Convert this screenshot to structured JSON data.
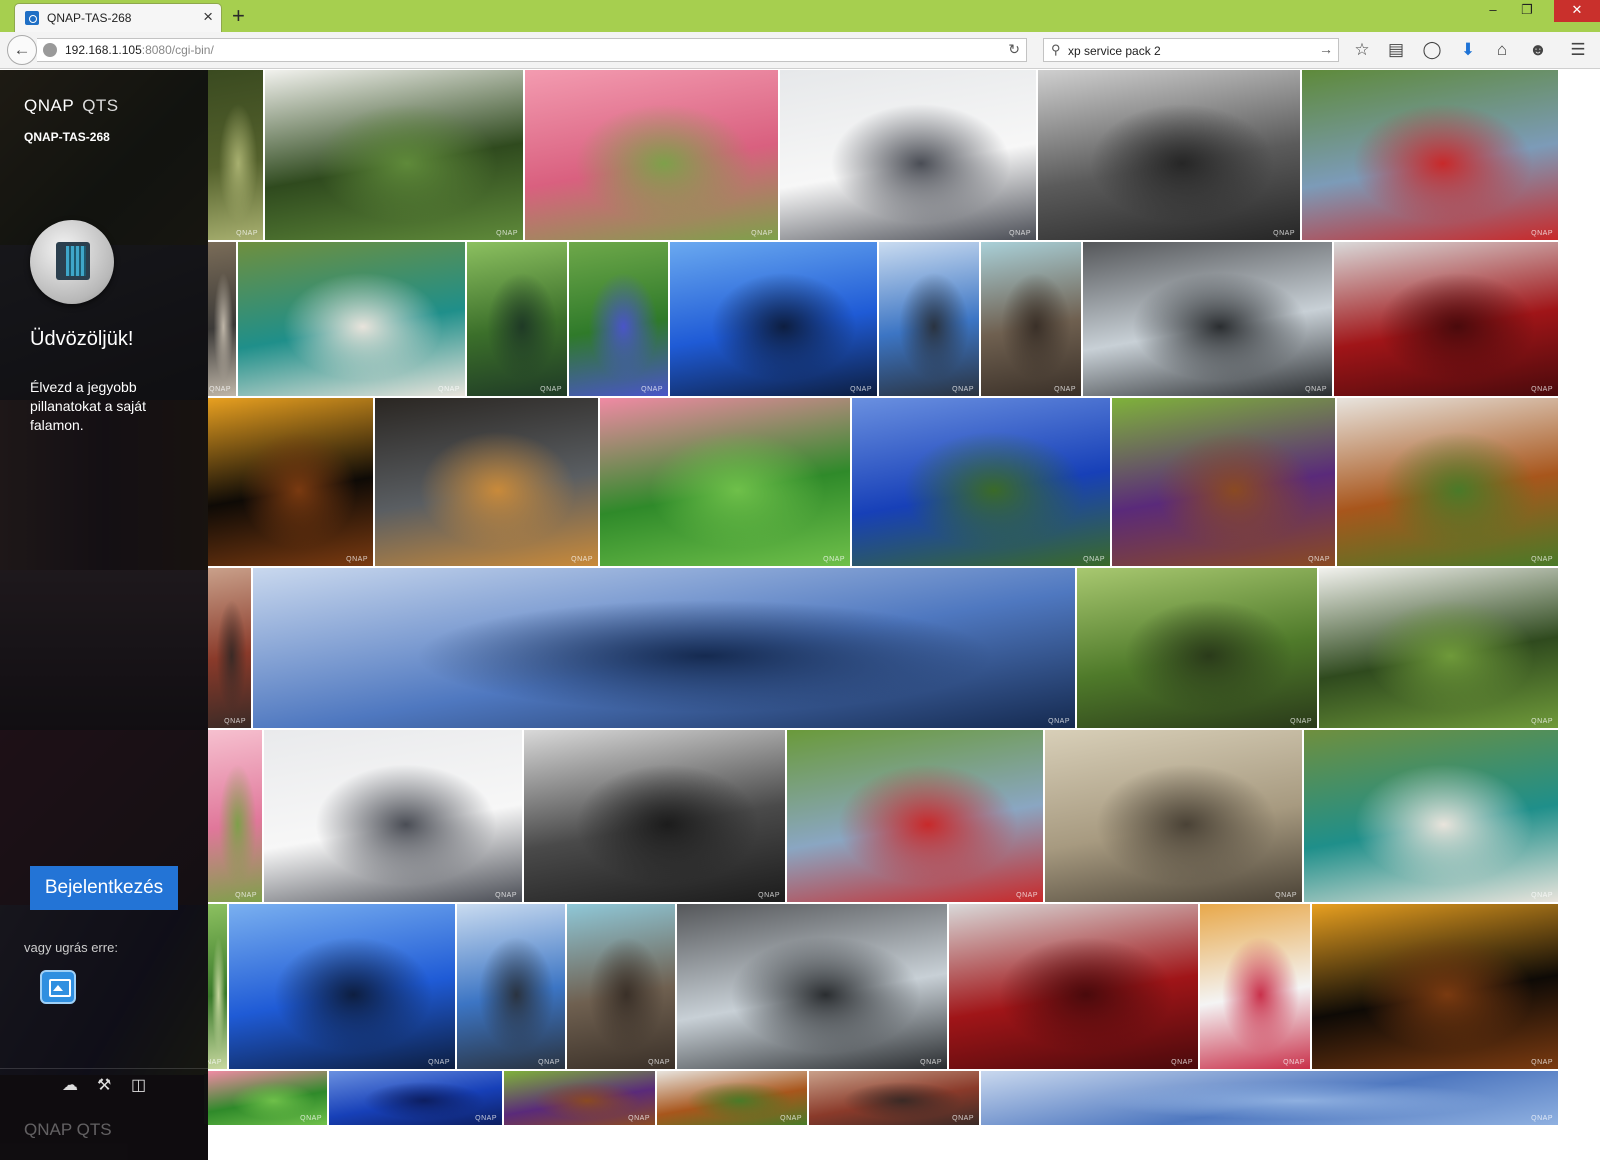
{
  "browser": {
    "tab_title": "QNAP-TAS-268",
    "tab_close": "×",
    "new_tab": "+",
    "url_host": "192.168.1.105",
    "url_rest": ":8080/cgi-bin/",
    "search_value": "xp service pack 2",
    "icons": [
      "back-arrow-icon",
      "globe-icon",
      "reload-icon",
      "search-icon",
      "go-arrow-icon",
      "bookmark-star-icon",
      "reading-list-icon",
      "pocket-icon",
      "download-icon",
      "home-icon",
      "chat-icon",
      "menu-icon"
    ],
    "window_buttons": [
      "–",
      "❐",
      "✕"
    ]
  },
  "sidebar": {
    "brand": "QNAP",
    "brand_product": "QTS",
    "device_name": "QNAP-TAS-268",
    "welcome_title": "Üdvözöljük!",
    "welcome_text": "Élvezd a jegyobb pillanatokat a saját falamon.",
    "login_label": "Bejelentkezés",
    "jump_label": "vagy ugrás erre:",
    "app_icon": "photo-station-icon",
    "bottom_icons": [
      "cloud-icon",
      "tools-icon",
      "book-icon"
    ],
    "menu_toggle": "☰",
    "footer_brand": "QNAP",
    "footer_product": "QTS"
  },
  "gallery": {
    "watermark": "QNAP",
    "photos": [
      {
        "name": "tree-lake",
        "colors": [
          "#54612c",
          "#3a4a20",
          "#a8b070"
        ]
      },
      {
        "name": "white-cyclamen",
        "colors": [
          "#2f4a1e",
          "#f2f2ee",
          "#5f8a3a"
        ]
      },
      {
        "name": "pink-blossoms",
        "colors": [
          "#d9607f",
          "#f39bb0",
          "#7ea04a"
        ]
      },
      {
        "name": "misty-pier",
        "colors": [
          "#f7f7f7",
          "#e6e8ea",
          "#4a4d55"
        ]
      },
      {
        "name": "bw-coastline",
        "colors": [
          "#5b5b5b",
          "#cfcfcf",
          "#262626"
        ]
      },
      {
        "name": "red-tractor",
        "colors": [
          "#7c9bb8",
          "#5e8a3a",
          "#c8292a"
        ]
      },
      {
        "name": "coastal-pier-edge",
        "colors": [
          "#3c3a38",
          "#7a6c58",
          "#bfb6a8"
        ]
      },
      {
        "name": "aerial-heart-reef",
        "colors": [
          "#1f8f8a",
          "#6f8f3e",
          "#e9e4dc"
        ]
      },
      {
        "name": "forest-river",
        "colors": [
          "#3b6f2a",
          "#8cc060",
          "#1f3a26"
        ]
      },
      {
        "name": "blue-agapanthus",
        "colors": [
          "#2f7a2a",
          "#6ea84a",
          "#4a55c8"
        ]
      },
      {
        "name": "water-villas",
        "colors": [
          "#1f5bd6",
          "#6aa9f0",
          "#0d1e40"
        ]
      },
      {
        "name": "yacht-harbor",
        "colors": [
          "#3c75c4",
          "#c9dbf0",
          "#2a3340"
        ]
      },
      {
        "name": "rock-channel",
        "colors": [
          "#6f6050",
          "#a9d0d8",
          "#3a3028"
        ]
      },
      {
        "name": "canal-warehouses",
        "colors": [
          "#c8d0d6",
          "#55575a",
          "#2a2d30"
        ]
      },
      {
        "name": "audi-racecar",
        "colors": [
          "#a01518",
          "#d9d9d9",
          "#4a0a0c"
        ]
      },
      {
        "name": "night-carousel",
        "colors": [
          "#0e0a06",
          "#e8a020",
          "#7a3a10"
        ]
      },
      {
        "name": "rainy-window",
        "colors": [
          "#5a5e62",
          "#2a2622",
          "#c98a3a"
        ]
      },
      {
        "name": "pink-bud",
        "colors": [
          "#2f8a2a",
          "#f08aa4",
          "#6fc04a"
        ]
      },
      {
        "name": "blue-sky-cliff",
        "colors": [
          "#1740b8",
          "#6a90e0",
          "#3a6a28"
        ]
      },
      {
        "name": "eggplant-dish",
        "colors": [
          "#5a2a7a",
          "#7fb23a",
          "#8a4a22"
        ]
      },
      {
        "name": "stew-rosemary",
        "colors": [
          "#a8561c",
          "#e8e4de",
          "#4a7a28"
        ]
      },
      {
        "name": "brick-edge",
        "colors": [
          "#8a3a2a",
          "#c9a08a",
          "#3a2a26"
        ]
      },
      {
        "name": "panorama-sea",
        "colors": [
          "#4f78c0",
          "#c9d8ee",
          "#152a50"
        ]
      },
      {
        "name": "tree-lake-reflection",
        "colors": [
          "#4f7a2a",
          "#a8c870",
          "#2a3a1a"
        ]
      },
      {
        "name": "cyclamen-2",
        "colors": [
          "#2f4a1e",
          "#f2f2ee",
          "#6f9a3a"
        ]
      },
      {
        "name": "pink-edge",
        "colors": [
          "#e0779a",
          "#f6c0cf",
          "#7ea04a"
        ]
      },
      {
        "name": "misty-pier-2",
        "colors": [
          "#f7f7f7",
          "#e9eaec",
          "#4a4d55"
        ]
      },
      {
        "name": "bw-waves",
        "colors": [
          "#4a4a4a",
          "#d9d9d9",
          "#1c1c1c"
        ]
      },
      {
        "name": "tractor-field",
        "colors": [
          "#8aa6c2",
          "#6a9a3a",
          "#c8292a"
        ]
      },
      {
        "name": "sepia-street",
        "colors": [
          "#a79a80",
          "#d8cfb8",
          "#4a4236"
        ]
      },
      {
        "name": "heart-reef-2",
        "colors": [
          "#1f8f8a",
          "#6f8f3e",
          "#e9e4dc"
        ]
      },
      {
        "name": "green-edge",
        "colors": [
          "#3a7a2a",
          "#8cc060",
          "#c8d8a0"
        ]
      },
      {
        "name": "water-villas-2",
        "colors": [
          "#1f5bd6",
          "#7ab0f0",
          "#0d1e40"
        ]
      },
      {
        "name": "yacht-2",
        "colors": [
          "#3c75c4",
          "#c9dbf0",
          "#2a3340"
        ]
      },
      {
        "name": "rock-channel-2",
        "colors": [
          "#6f6050",
          "#8fc8d8",
          "#3a3028"
        ]
      },
      {
        "name": "canal-2",
        "colors": [
          "#c8d0d6",
          "#55575a",
          "#2a2d30"
        ]
      },
      {
        "name": "audi-2",
        "colors": [
          "#a01518",
          "#d9d9d9",
          "#4a0a0c"
        ]
      },
      {
        "name": "ice-cream",
        "colors": [
          "#f4f4f4",
          "#e8a84a",
          "#c9304a"
        ]
      },
      {
        "name": "carousel-2",
        "colors": [
          "#0e0a06",
          "#e8a020",
          "#7a3a10"
        ]
      },
      {
        "name": "pink-bud-partial",
        "colors": [
          "#2f8a2a",
          "#f08aa4",
          "#6fc04a"
        ]
      },
      {
        "name": "blue-sky-partial",
        "colors": [
          "#1740b8",
          "#6a90e0",
          "#0d1e60"
        ]
      },
      {
        "name": "eggplant-partial",
        "colors": [
          "#5a2a7a",
          "#7fb23a",
          "#8a4a22"
        ]
      },
      {
        "name": "stew-partial",
        "colors": [
          "#a8561c",
          "#e8e4de",
          "#4a7a28"
        ]
      },
      {
        "name": "brick-partial",
        "colors": [
          "#8a3a2a",
          "#c9a08a",
          "#3a2a26"
        ]
      },
      {
        "name": "panorama-partial",
        "colors": [
          "#4f78c0",
          "#c9d8ee",
          "#8fb0e0"
        ]
      }
    ]
  }
}
